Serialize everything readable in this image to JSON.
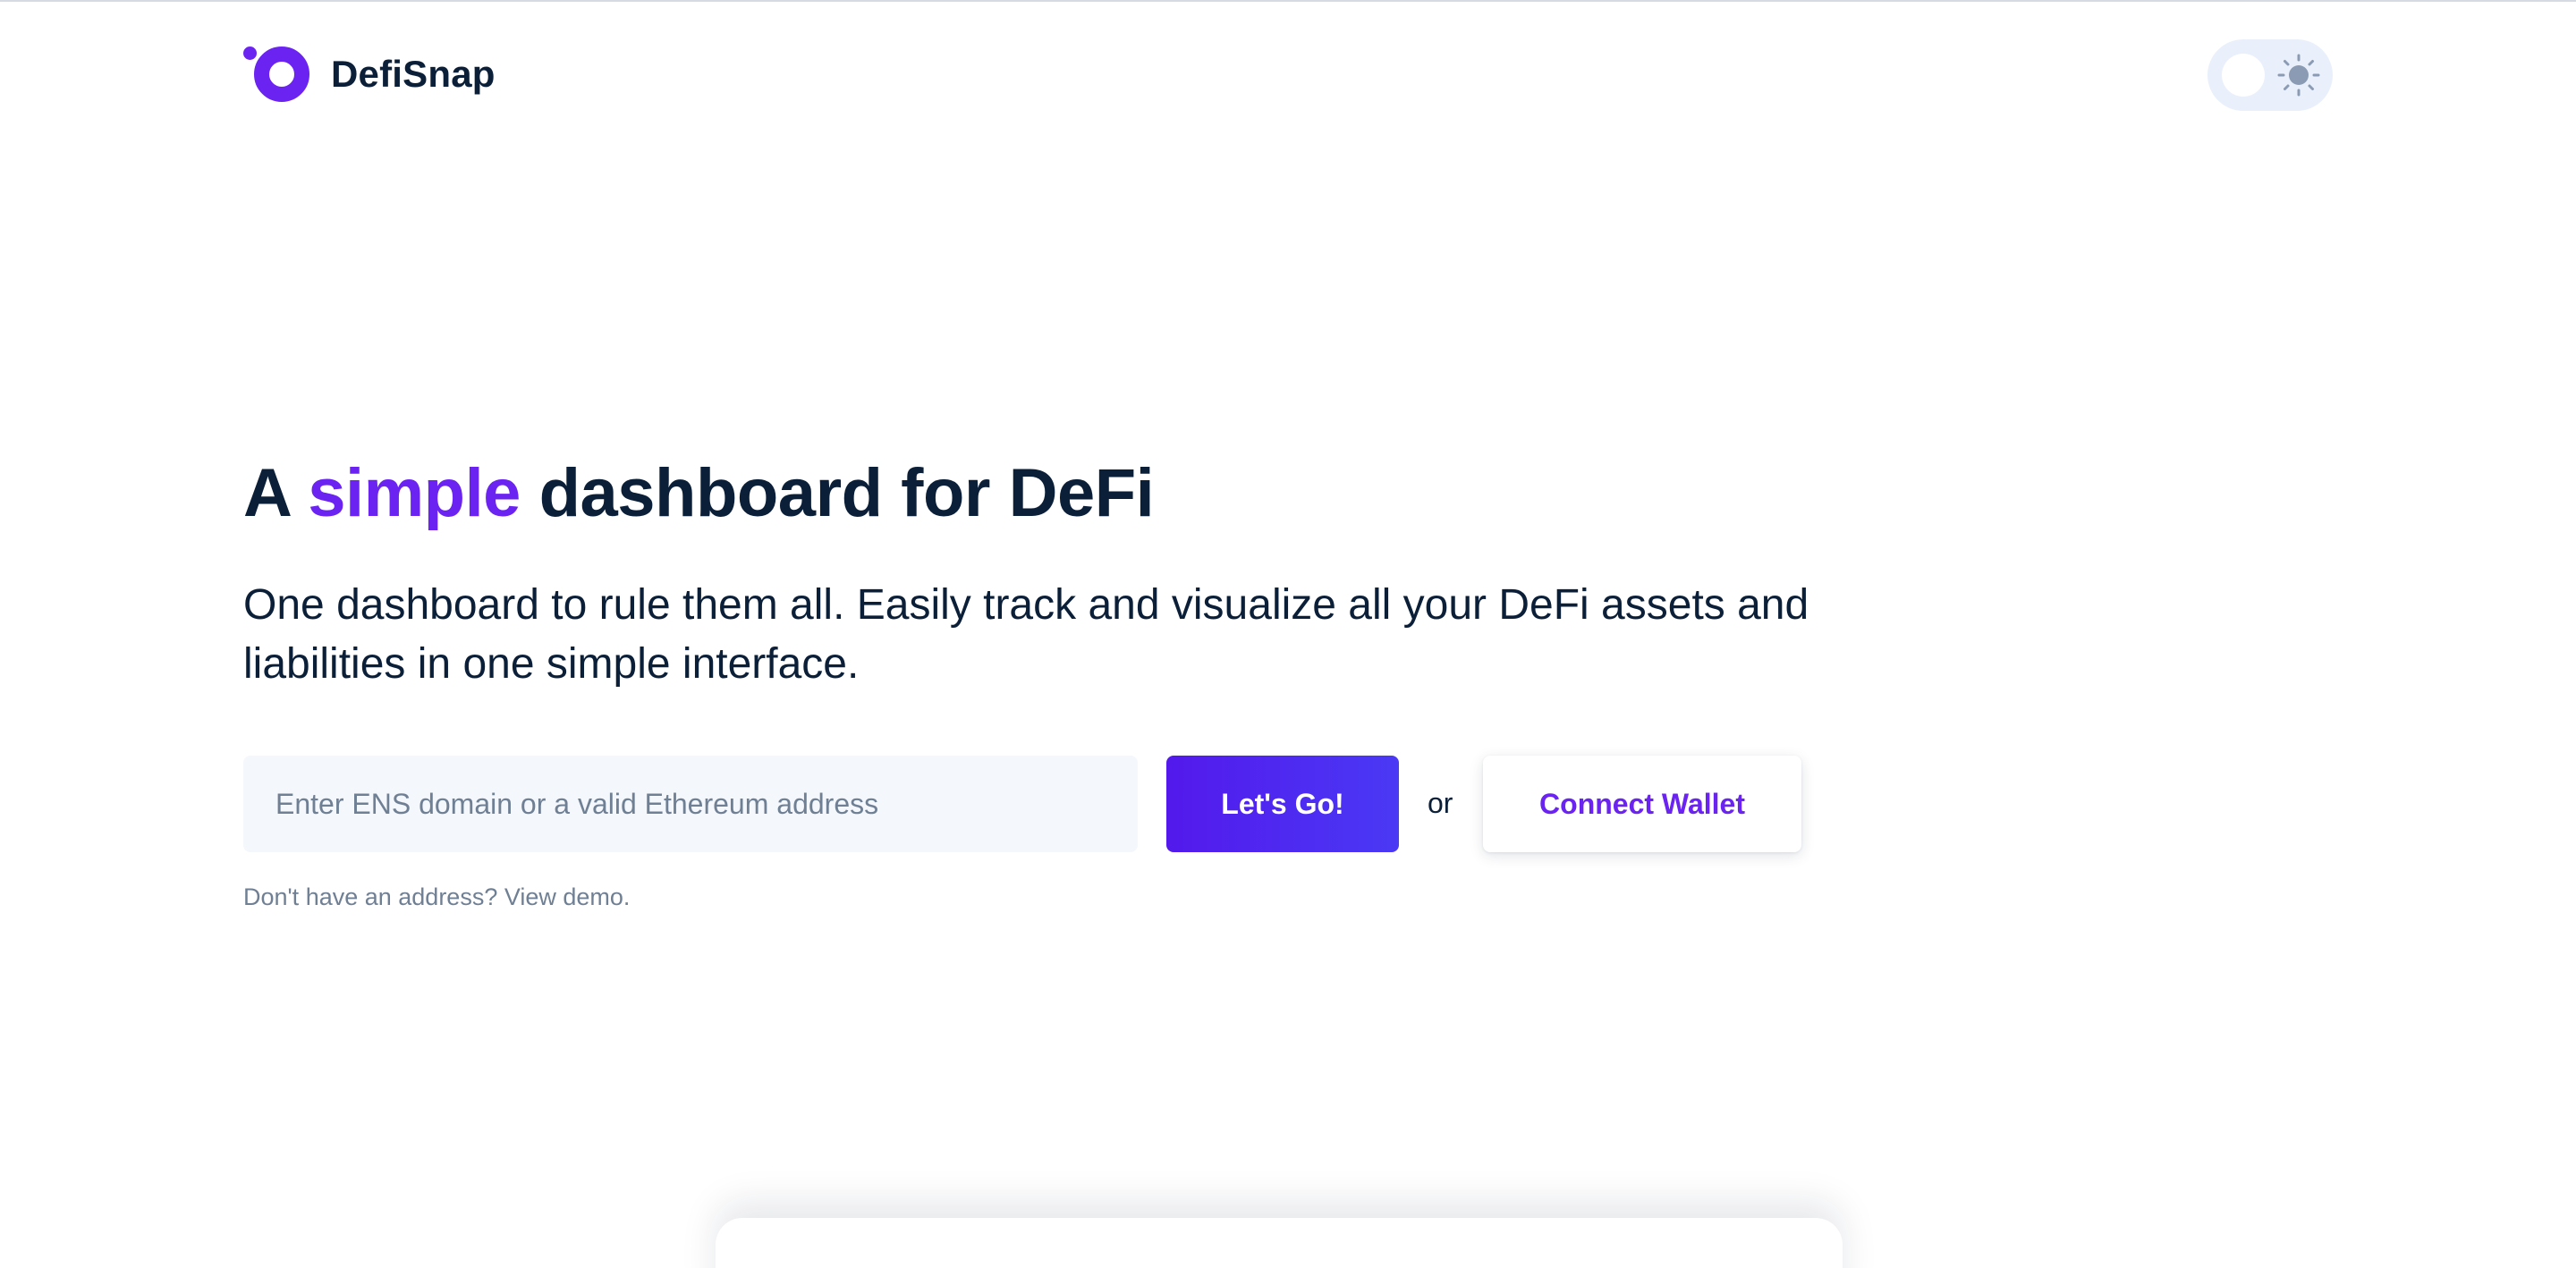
{
  "header": {
    "brand": "DefiSnap"
  },
  "theme_toggle": {
    "icon": "sun-icon"
  },
  "hero": {
    "title_prefix": "A ",
    "title_accent": "simple",
    "title_suffix": " dashboard for DeFi",
    "subtitle": "One dashboard to rule them all. Easily track and visualize all your DeFi assets and liabilities in one simple interface."
  },
  "search": {
    "placeholder": "Enter ENS domain or a valid Ethereum address",
    "value": "",
    "go_label": "Let's Go!",
    "or_label": "or",
    "connect_label": "Connect Wallet"
  },
  "demo": {
    "prefix": "Don't have an address? ",
    "link": "View demo."
  },
  "colors": {
    "accent": "#6b23f2",
    "text": "#0b1f38",
    "muted": "#6f7f94",
    "button_gradient_start": "#5319ec",
    "button_gradient_end": "#4a39f5",
    "input_bg": "#f4f7fb",
    "toggle_bg": "#e9f0fb"
  }
}
